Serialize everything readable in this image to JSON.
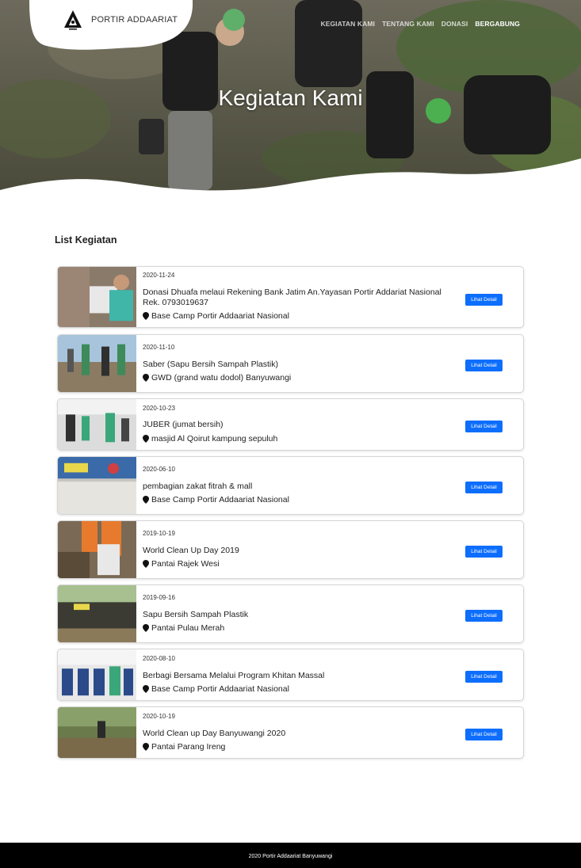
{
  "brand": {
    "name": "PORTIR ADDAARIAT",
    "logo_icon": "triangle-logo-icon"
  },
  "nav": {
    "items": [
      {
        "label": "KEGIATAN KAMI",
        "active": false
      },
      {
        "label": "TENTANG KAMI",
        "active": false
      },
      {
        "label": "DONASI",
        "active": false
      },
      {
        "label": "BERGABUNG",
        "active": true
      }
    ]
  },
  "hero": {
    "title": "Kegiatan Kami"
  },
  "list": {
    "title": "List Kegiatan",
    "button_label": "Lihat Detail",
    "items": [
      {
        "date": "2020-11-24",
        "title": "Donasi Dhuafa melaui Rekening Bank Jatim An.Yayasan Portir Addariat Nasional Rek. 0793019637",
        "location": "Base Camp Portir Addaariat Nasional"
      },
      {
        "date": "2020-11-10",
        "title": "Saber (Sapu Bersih Sampah Plastik)",
        "location": "GWD (grand watu dodol) Banyuwangi"
      },
      {
        "date": "2020-10-23",
        "title": "JUBER (jumat bersih)",
        "location": "masjid Al Qoirut kampung sepuluh"
      },
      {
        "date": "2020-06-10",
        "title": "pembagian zakat fitrah & mall",
        "location": "Base Camp Portir Addaariat Nasional"
      },
      {
        "date": "2019-10-19",
        "title": "World Clean Up Day 2019",
        "location": "Pantai Rajek Wesi"
      },
      {
        "date": "2019-09-16",
        "title": "Sapu Bersih Sampah Plastik",
        "location": "Pantai Pulau Merah"
      },
      {
        "date": "2020-08-10",
        "title": "Berbagi Bersama Melalui Program Khitan Massal",
        "location": "Base Camp Portir Addaariat Nasional"
      },
      {
        "date": "2020-10-19",
        "title": "World Clean up Day Banyuwangi 2020",
        "location": "Pantai Parang Ireng"
      }
    ]
  },
  "footer": {
    "text": "2020 Portir Addaariat Banyuwangi"
  },
  "colors": {
    "button": "#0d6efd",
    "footer_bg": "#000000"
  }
}
